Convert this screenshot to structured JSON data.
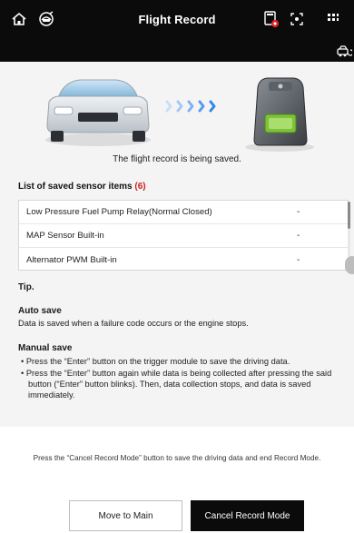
{
  "header": {
    "title": "Flight Record",
    "icons": [
      "home-icon",
      "vehicle-scan-icon",
      "recording-icon",
      "capture-icon",
      "grid-icon",
      "vehicle-reload-icon"
    ]
  },
  "illustration": {
    "caption": "The flight record is being saved."
  },
  "sensor_list": {
    "title": "List of saved sensor items",
    "count": "(6)",
    "items": [
      {
        "name": "Low Pressure Fuel Pump Relay(Normal Closed)",
        "value": "-"
      },
      {
        "name": "MAP Sensor Built-in",
        "value": "-"
      },
      {
        "name": "Alternator PWM Built-in",
        "value": "-"
      }
    ]
  },
  "tip": {
    "title": "Tip.",
    "auto_save_heading": "Auto save",
    "auto_save_text": "Data is saved when a failure code occurs or the engine stops.",
    "manual_save_heading": "Manual save",
    "manual_save_items": [
      "Press the “Enter” button on the trigger module to save the driving data.",
      "Press the “Enter” button again while data is being collected after pressing the said button (“Enter” button blinks). Then, data collection stops, and data is saved immediately."
    ]
  },
  "footer": {
    "notice": "Press the “Cancel Record Mode” button to save the driving data and end Record Mode.",
    "move_to_main_label": "Move to Main",
    "cancel_record_label": "Cancel Record Mode"
  },
  "colors": {
    "header_bg": "#0b0b0b",
    "count_red": "#d21f1f",
    "arrow_blue": "#2f86e8",
    "recording_red": "#e02424"
  }
}
